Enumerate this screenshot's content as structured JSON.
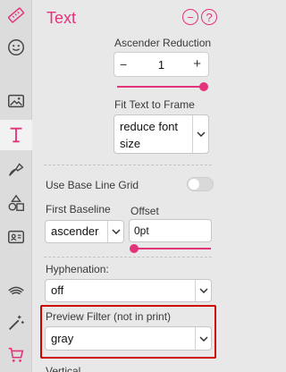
{
  "rail": {
    "icons": [
      "ruler-icon",
      "sticker-icon",
      "image-icon",
      "text-icon",
      "pen-tool-icon",
      "shapes-icon",
      "id-card-icon",
      "tag-icon",
      "magic-wand-icon",
      "cart-icon"
    ],
    "active": "text-icon",
    "accent": "#e2337b"
  },
  "panel": {
    "title": "Text",
    "ascender_reduction": {
      "label": "Ascender Reduction",
      "minus": "−",
      "value": "1",
      "plus": "+"
    },
    "fit_text": {
      "label": "Fit Text to Frame",
      "value_line1": "reduce font",
      "value_line2": "size"
    },
    "baseline_grid": {
      "label": "Use Base Line Grid",
      "enabled": false
    },
    "first_baseline": {
      "label": "First Baseline",
      "value": "ascender"
    },
    "offset": {
      "label": "Offset",
      "value": "0pt"
    },
    "hyphenation": {
      "label": "Hyphenation:",
      "value": "off"
    },
    "preview_filter": {
      "label": "Preview Filter (not in print)",
      "value": "gray"
    },
    "next_label": "Vertical"
  }
}
